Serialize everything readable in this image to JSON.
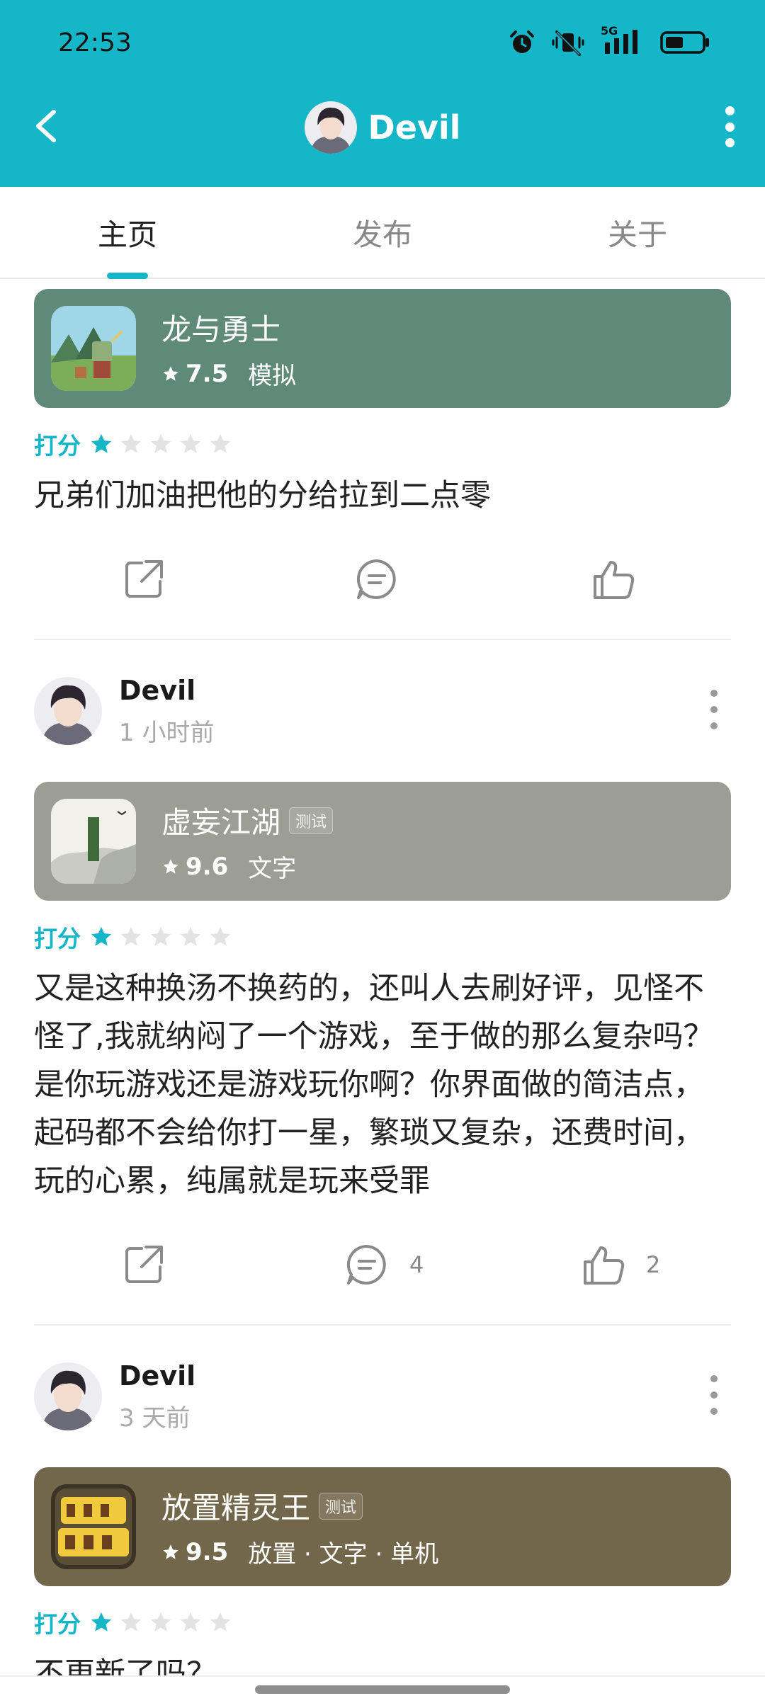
{
  "status_bar": {
    "time": "22:53",
    "network": "5G"
  },
  "header": {
    "title": "Devil"
  },
  "tabs": [
    {
      "label": "主页",
      "active": true
    },
    {
      "label": "发布",
      "active": false
    },
    {
      "label": "关于",
      "active": false
    }
  ],
  "colors": {
    "accent": "#15b6c7"
  },
  "posts": [
    {
      "game": {
        "name": "龙与勇士",
        "score": "7.5",
        "tags": "模拟",
        "card_color": "#5f8a7a"
      },
      "rating_label": "打分",
      "stars": 1,
      "review": "兄弟们加油把他的分给拉到二点零"
    },
    {
      "author": "Devil",
      "time": "1 小时前",
      "game": {
        "name": "虚妄江湖",
        "badge": "测试",
        "score": "9.6",
        "tags": "文字",
        "card_color": "#9c9e96"
      },
      "rating_label": "打分",
      "stars": 1,
      "review": "又是这种换汤不换药的，还叫人去刷好评，见怪不怪了,我就纳闷了一个游戏，至于做的那么复杂吗？是你玩游戏还是游戏玩你啊？你界面做的简洁点，起码都不会给你打一星，繁琐又复杂，还费时间，玩的心累，纯属就是玩来受罪",
      "comments": "4",
      "likes": "2"
    },
    {
      "author": "Devil",
      "time": "3 天前",
      "game": {
        "name": "放置精灵王",
        "badge": "测试",
        "score": "9.5",
        "tags": "放置 · 文字 · 单机",
        "card_color": "#73674b"
      },
      "rating_label": "打分",
      "stars": 1,
      "review": "不更新了吗？"
    }
  ]
}
